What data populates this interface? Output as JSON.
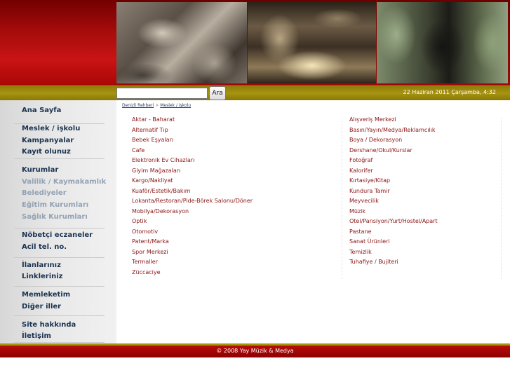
{
  "search": {
    "placeholder": "",
    "value": "",
    "button_label": "Ara"
  },
  "header": {
    "datetime": "22 Haziran 2011 Çarşamba, 4:32"
  },
  "breadcrumb": {
    "root": "Denizli Rehberi",
    "separator": ">",
    "current": "Meslek / işkolu"
  },
  "sidebar": {
    "items": [
      {
        "label": "Ana Sayfa",
        "muted": false
      },
      {
        "label": "Meslek / işkolu",
        "muted": false
      },
      {
        "label": "Kampanyalar",
        "muted": false
      },
      {
        "label": "Kayıt olunuz",
        "muted": false
      },
      {
        "label": "Kurumlar",
        "muted": false
      },
      {
        "label": "Valilik / Kaymakamlık",
        "muted": true
      },
      {
        "label": "Belediyeler",
        "muted": true
      },
      {
        "label": "Eğitim Kurumları",
        "muted": true
      },
      {
        "label": "Sağlık Kurumları",
        "muted": true
      },
      {
        "label": "Nöbetçi eczaneler",
        "muted": false
      },
      {
        "label": "Acil tel. no.",
        "muted": false
      },
      {
        "label": "İlanlarınız",
        "muted": false
      },
      {
        "label": "Linkleriniz",
        "muted": false
      },
      {
        "label": "Memleketim",
        "muted": false
      },
      {
        "label": "Diğer iller",
        "muted": false
      },
      {
        "label": "Site hakkında",
        "muted": false
      },
      {
        "label": "İletişim",
        "muted": false
      }
    ]
  },
  "categories": {
    "left": [
      "Aktar - Baharat",
      "Alternatif Tıp",
      "Bebek Eşyaları",
      "Cafe",
      "Elektronik Ev Cihazları",
      "Giyim Mağazaları",
      "Kargo/Nakliyat",
      "Kuaför/Estetik/Bakım",
      "Lokanta/Restoran/Pide-Börek Salonu/Döner",
      "Mobilya/Dekorasyon",
      "Optik",
      "Otomotiv",
      "Patent/Marka",
      "Spor Merkezi",
      "Termaller",
      "Züccaciye"
    ],
    "right": [
      "Alışveriş Merkezi",
      "Basın/Yayın/Medya/Reklamcılık",
      "Boya / Dekorasyon",
      "Dershane/Okul/Kurslar",
      "Fotoğraf",
      "Kalorifer",
      "Kırtasiye/Kitap",
      "Kundura Tamir",
      "Meyvecilik",
      "Müzik",
      "Otel/Pansiyon/Yurt/Hostel/Apart",
      "Pastane",
      "Sanat Ürünleri",
      "Temizlik",
      "Tuhafiye / Bujiteri"
    ]
  },
  "footer": {
    "text": "© 2008 Yay Müzik & Medya"
  },
  "colors": {
    "brand_red": "#a40b0b",
    "olive": "#a79411",
    "link": "#8b1414",
    "nav": "#1a3350",
    "nav_muted": "#93a2b4"
  }
}
